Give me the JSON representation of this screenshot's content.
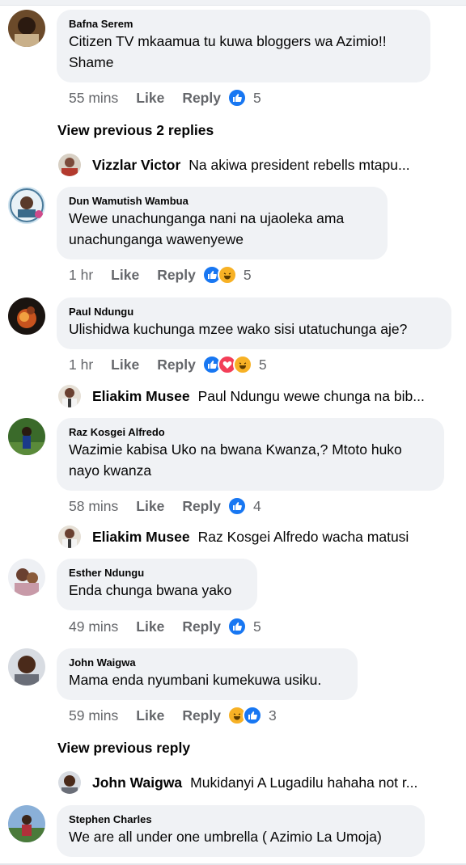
{
  "comments": [
    {
      "author": "Bafna Serem",
      "line1": "Citizen TV mkaamua tu kuwa bloggers wa Azimio!!",
      "line2": "Shame",
      "time": "55 mins",
      "like": "Like",
      "reply": "Reply",
      "count": "5"
    },
    {
      "author": "Dun Wamutish Wambua",
      "line1": "Wewe unachunganga nani  na ujaoleka  ama",
      "line2": "unachunganga wawenyewe",
      "time": "1 hr",
      "like": "Like",
      "reply": "Reply",
      "count": "5"
    },
    {
      "author": "Paul Ndungu",
      "line1": "Ulishidwa kuchunga mzee wako sisi utatuchunga aje?",
      "time": "1 hr",
      "like": "Like",
      "reply": "Reply",
      "count": "5"
    },
    {
      "author": "Raz Kosgei Alfredo",
      "line1": "Wazimie kabisa Uko na bwana Kwanza,? Mtoto huko",
      "line2": "nayo kwanza",
      "time": "58 mins",
      "like": "Like",
      "reply": "Reply",
      "count": "4"
    },
    {
      "author": "Esther Ndungu",
      "line1": "Enda chunga bwana yako",
      "time": "49 mins",
      "like": "Like",
      "reply": "Reply",
      "count": "5"
    },
    {
      "author": "John Waigwa",
      "line1": "Mama enda nyumbani kumekuwa usiku.",
      "time": "59 mins",
      "like": "Like",
      "reply": "Reply",
      "count": "3"
    },
    {
      "author": "Stephen Charles",
      "line1": "We are all under one umbrella ( Azimio La Umoja)"
    }
  ],
  "view_previous": [
    "View previous 2 replies",
    "View previous reply"
  ],
  "replies": [
    {
      "author": "Vizzlar Victor",
      "text": "Na akiwa president rebells mtapu..."
    },
    {
      "author": "Eliakim Musee",
      "text": "Paul Ndungu wewe chunga na bib..."
    },
    {
      "author": "Eliakim Musee",
      "text": "Raz Kosgei Alfredo wacha matusi"
    },
    {
      "author": "John Waigwa",
      "text": "Mukidanyi A Lugadilu hahaha not r..."
    }
  ],
  "colors": {
    "like_blue": "#1877f2",
    "love_red": "#f33e58",
    "haha_yellow": "#f7b125",
    "bubble": "#f0f2f5",
    "meta": "#65676b"
  },
  "icons": {
    "like": "thumbs-up-icon",
    "love": "heart-icon",
    "haha": "laughing-face-icon"
  }
}
